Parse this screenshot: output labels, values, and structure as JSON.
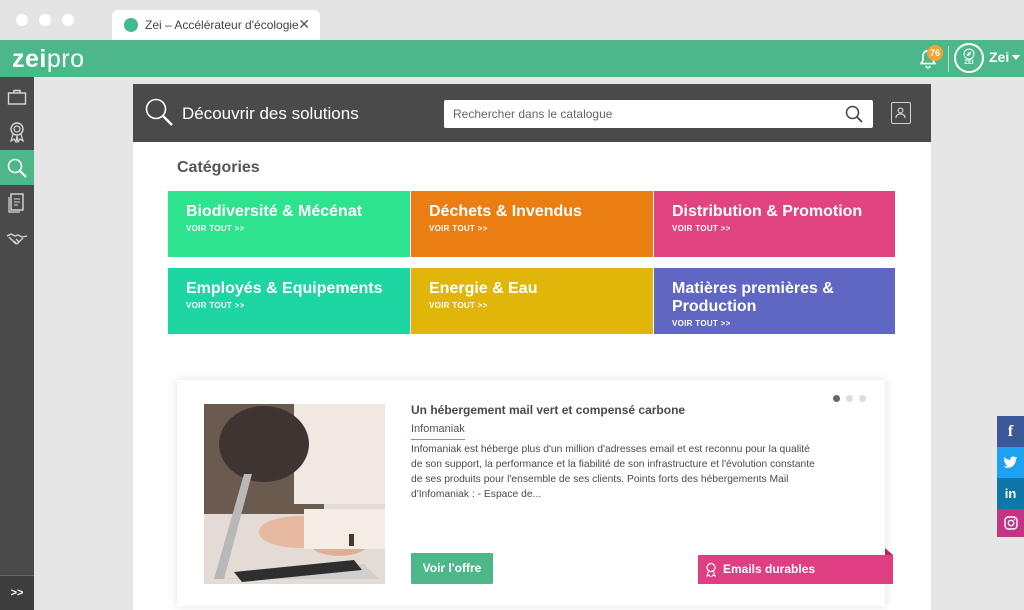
{
  "browser": {
    "tab_title": "Zei – Accélérateur d'écologie",
    "tab_close": "✕"
  },
  "appbar": {
    "logo_bold": "zei",
    "logo_light": "pro",
    "notifications_count": "76",
    "avatar_text": "ZEI",
    "user_name": "Zei",
    "accent_color": "#4cb88a"
  },
  "sidebar": {
    "items": [
      {
        "icon": "briefcase-icon",
        "active": false
      },
      {
        "icon": "award-ribbon-icon",
        "active": false
      },
      {
        "icon": "search-icon",
        "active": true
      },
      {
        "icon": "document-icon",
        "active": false
      },
      {
        "icon": "handshake-icon",
        "active": false
      }
    ],
    "expand_label": ">>"
  },
  "header": {
    "title": "Découvrir des solutions",
    "search_placeholder": "Rechercher dans le catalogue"
  },
  "categories": {
    "heading": "Catégories",
    "items": [
      {
        "title": "Biodiversité & Mécénat",
        "link": "VOIR TOUT >>",
        "color": "#2ee38e"
      },
      {
        "title": "Déchets & Invendus",
        "link": "VOIR TOUT >>",
        "color": "#eb7e13"
      },
      {
        "title": "Distribution & Promotion",
        "link": "VOIR TOUT >>",
        "color": "#e2447f"
      },
      {
        "title": "Employés & Equipements",
        "link": "VOIR TOUT >>",
        "color": "#1ed6a1"
      },
      {
        "title": "Energie & Eau",
        "link": "VOIR TOUT >>",
        "color": "#e0b60b"
      },
      {
        "title_line1": "Matières premières &",
        "title_line2": "Production",
        "link": "VOIR TOUT >>",
        "color": "#5f67c2"
      }
    ]
  },
  "offer": {
    "title": "Un hébergement mail vert et compensé carbone",
    "vendor": "Infomaniak",
    "description": "Infomaniak est héberge plus d'un million d'adresses email et est reconnu pour la qualité de son support, la performance et la fiabilité de son infrastructure et l'évolution constante de ses produits pour l'ensemble de ses clients. Points forts des hébergements Mail d'Infomaniak : - Espace de...",
    "button": "Voir l'offre",
    "tag": "Emails durables",
    "tag_color": "#e03e82",
    "pager_active_index": 0,
    "pager_count": 3
  },
  "social": [
    {
      "icon": "facebook-icon",
      "glyph": "f",
      "color": "#3b5998"
    },
    {
      "icon": "twitter-icon",
      "glyph": "",
      "color": "#1da1f2"
    },
    {
      "icon": "linkedin-icon",
      "glyph": "in",
      "color": "#0e76a8"
    },
    {
      "icon": "instagram-icon",
      "glyph": "",
      "color": "#c13584"
    }
  ]
}
